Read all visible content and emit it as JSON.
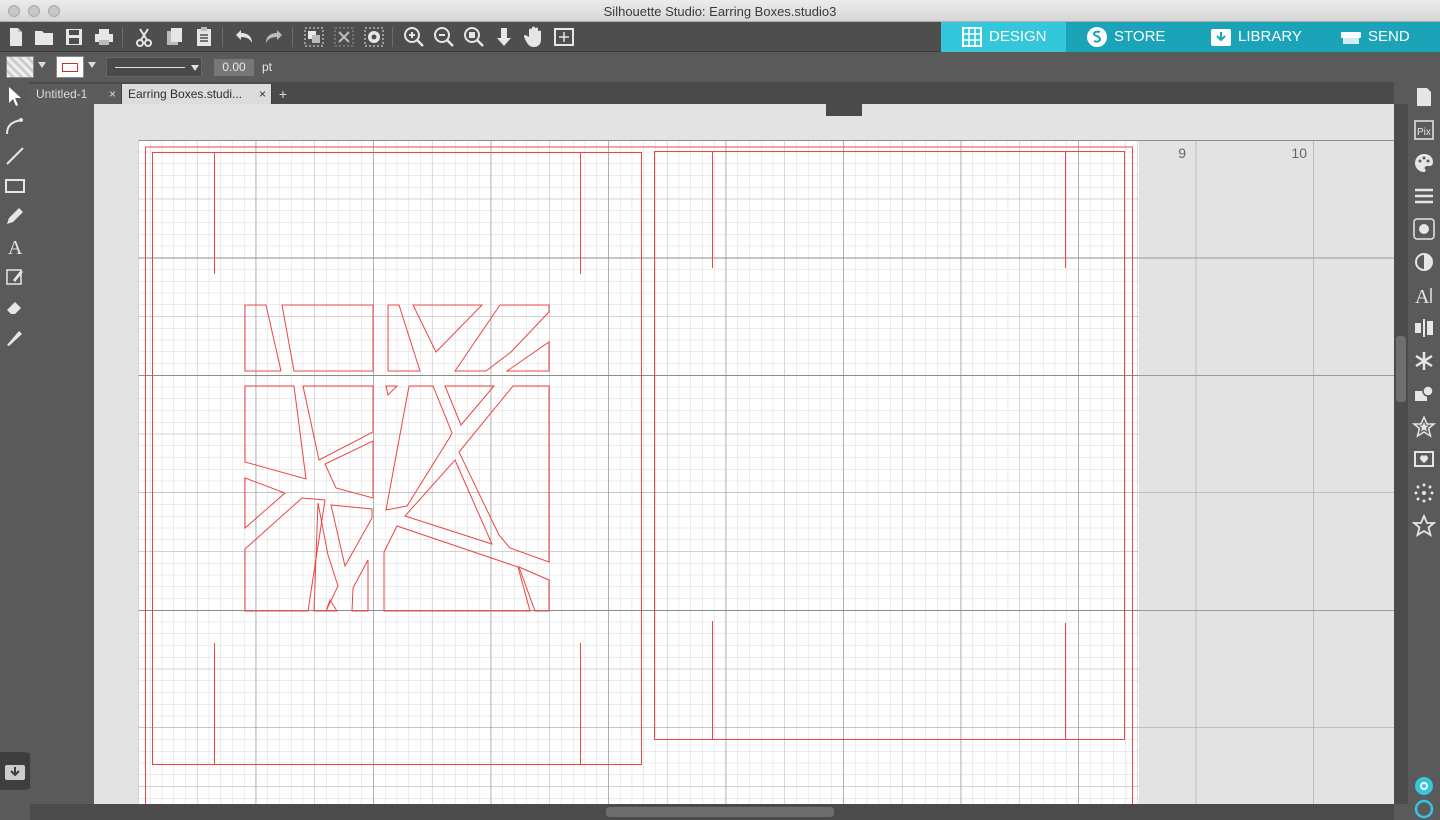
{
  "window": {
    "title": "Silhouette Studio: Earring Boxes.studio3"
  },
  "toolbar": {
    "icons": [
      "new-file-icon",
      "open-folder-icon",
      "save-icon",
      "print-icon",
      "cut-icon",
      "copy-icon",
      "paste-icon",
      "undo-icon",
      "redo-icon",
      "group-icon",
      "ungroup-icon",
      "compound-path-icon",
      "zoom-in-icon",
      "zoom-out-icon",
      "zoom-fit-icon",
      "move-down-icon",
      "pan-hand-icon",
      "fit-page-icon"
    ]
  },
  "nav": {
    "design": "DESIGN",
    "store": "STORE",
    "library": "LIBRARY",
    "send": "SEND"
  },
  "options": {
    "line_width": "0.00",
    "line_unit": "pt",
    "line_color": "#d42a2a"
  },
  "tabs": [
    {
      "label": "Untitled-1",
      "close": "×"
    },
    {
      "label": "Earring Boxes.studi...",
      "close": "×"
    }
  ],
  "new_tab": "+",
  "ruler": {
    "labels": [
      "9",
      "10"
    ]
  },
  "colors": {
    "accent": "#34c6da",
    "cut_line": "#ee4444",
    "grid_major": "#8a8a8a",
    "grid_minor": "#d8d8d8"
  }
}
